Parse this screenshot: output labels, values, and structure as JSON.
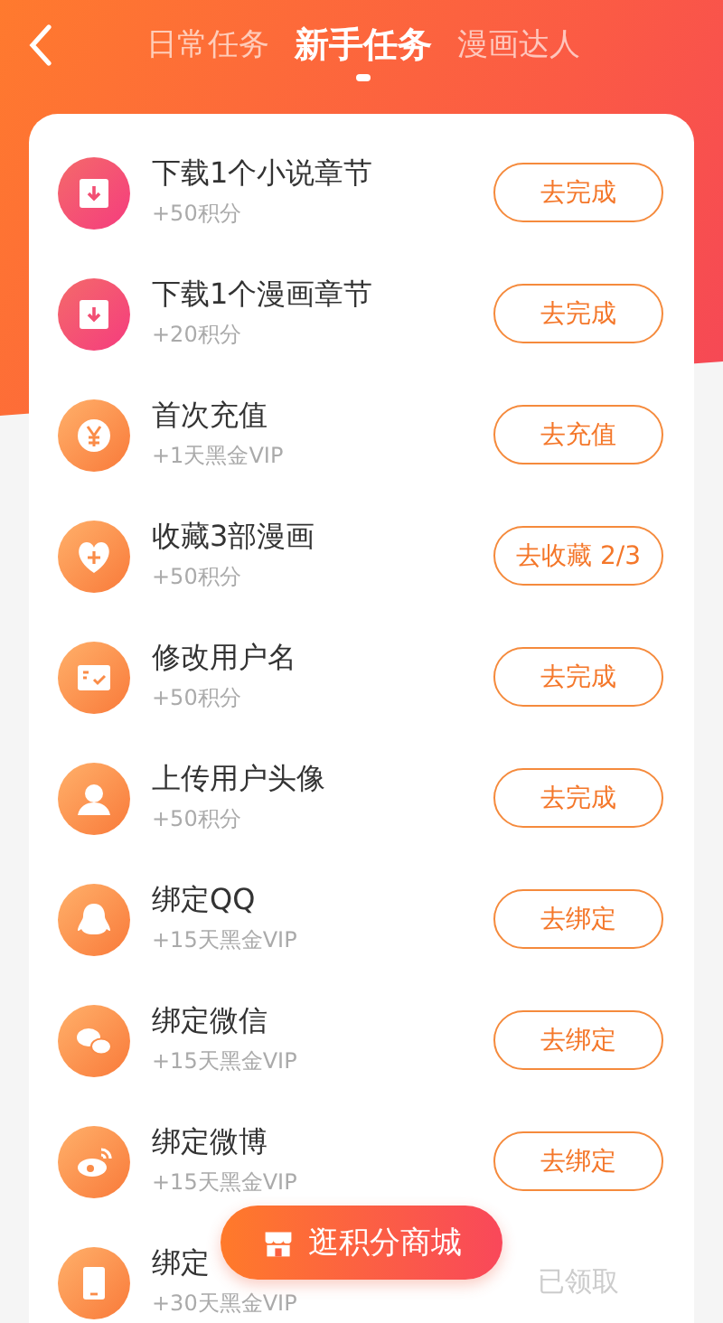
{
  "tabs": [
    {
      "label": "日常任务",
      "selected": false
    },
    {
      "label": "新手任务",
      "selected": true
    },
    {
      "label": "漫画达人",
      "selected": false
    }
  ],
  "tasks": [
    {
      "title": "下载1个小说章节",
      "reward": "+50积分",
      "action": "去完成",
      "claimed": false
    },
    {
      "title": "下载1个漫画章节",
      "reward": "+20积分",
      "action": "去完成",
      "claimed": false
    },
    {
      "title": "首次充值",
      "reward": "+1天黑金VIP",
      "action": "去充值",
      "claimed": false
    },
    {
      "title": "收藏3部漫画",
      "reward": "+50积分",
      "action": "去收藏 2/3",
      "claimed": false
    },
    {
      "title": "修改用户名",
      "reward": "+50积分",
      "action": "去完成",
      "claimed": false
    },
    {
      "title": "上传用户头像",
      "reward": "+50积分",
      "action": "去完成",
      "claimed": false
    },
    {
      "title": "绑定QQ",
      "reward": "+15天黑金VIP",
      "action": "去绑定",
      "claimed": false
    },
    {
      "title": "绑定微信",
      "reward": "+15天黑金VIP",
      "action": "去绑定",
      "claimed": false
    },
    {
      "title": "绑定微博",
      "reward": "+15天黑金VIP",
      "action": "去绑定",
      "claimed": false
    },
    {
      "title": "绑定",
      "reward": "+30天黑金VIP",
      "action": "已领取",
      "claimed": true
    }
  ],
  "mall_button": "逛积分商城"
}
